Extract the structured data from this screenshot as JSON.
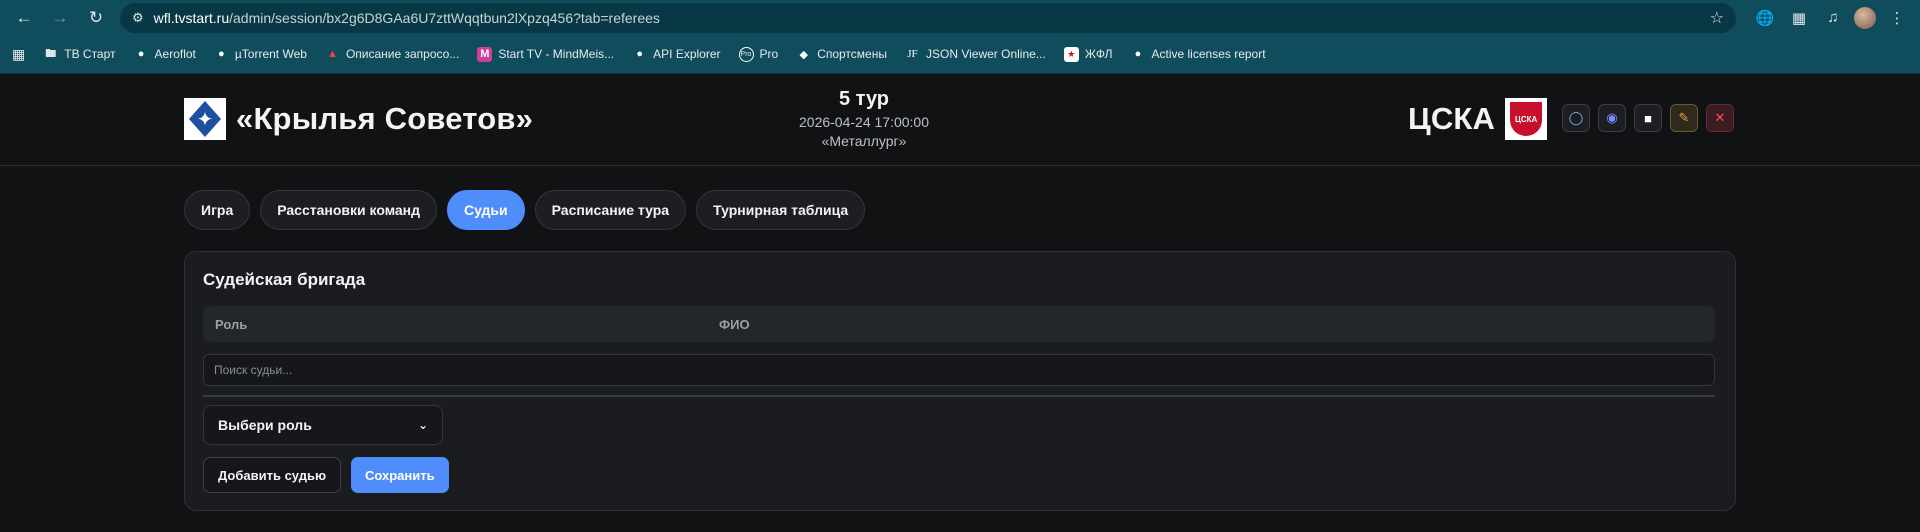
{
  "browser": {
    "url_host": "wfl.tvstart.ru",
    "url_path": "/admin/session/bx2g6D8GAa6U7zttWqqtbun2lXpzq456?tab=referees",
    "bookmarks": [
      {
        "label": "ТВ Старт",
        "icon": "folder-icon"
      },
      {
        "label": "Aeroflot",
        "icon": "globe-icon"
      },
      {
        "label": "µTorrent Web",
        "icon": "globe-icon"
      },
      {
        "label": "Описание запросо...",
        "icon": "pdf-icon"
      },
      {
        "label": "Start TV - MindMeis...",
        "icon": "mindmeister-icon"
      },
      {
        "label": "API Explorer",
        "icon": "globe-icon"
      },
      {
        "label": "Pro",
        "icon": "pro-icon"
      },
      {
        "label": "Спортсмены",
        "icon": "diamond-icon"
      },
      {
        "label": "JSON Viewer Online...",
        "icon": "jf-icon"
      },
      {
        "label": "ЖФЛ",
        "icon": "zhfl-icon"
      },
      {
        "label": "Active licenses report",
        "icon": "globe-icon"
      }
    ]
  },
  "match": {
    "home_team": "«Крылья Советов»",
    "away_team": "ЦСКА",
    "away_logo_text": "ЦСКА",
    "round": "5 тур",
    "datetime": "2026-04-24 17:00:00",
    "venue": "«Металлург»"
  },
  "tabs": [
    {
      "label": "Игра",
      "active": false
    },
    {
      "label": "Расстановки команд",
      "active": false
    },
    {
      "label": "Судьи",
      "active": true
    },
    {
      "label": "Расписание тура",
      "active": false
    },
    {
      "label": "Турнирная таблица",
      "active": false
    }
  ],
  "referees": {
    "title": "Судейская бригада",
    "columns": {
      "role": "Роль",
      "fio": "ФИО"
    },
    "search_placeholder": "Поиск судьи...",
    "role_select_value": "Выбери роль",
    "add_label": "Добавить судью",
    "save_label": "Сохранить"
  },
  "colors": {
    "accent": "#4f8dfb",
    "chrome": "#0f4c5c",
    "danger": "#ff4d5e",
    "warning": "#f0a030"
  }
}
